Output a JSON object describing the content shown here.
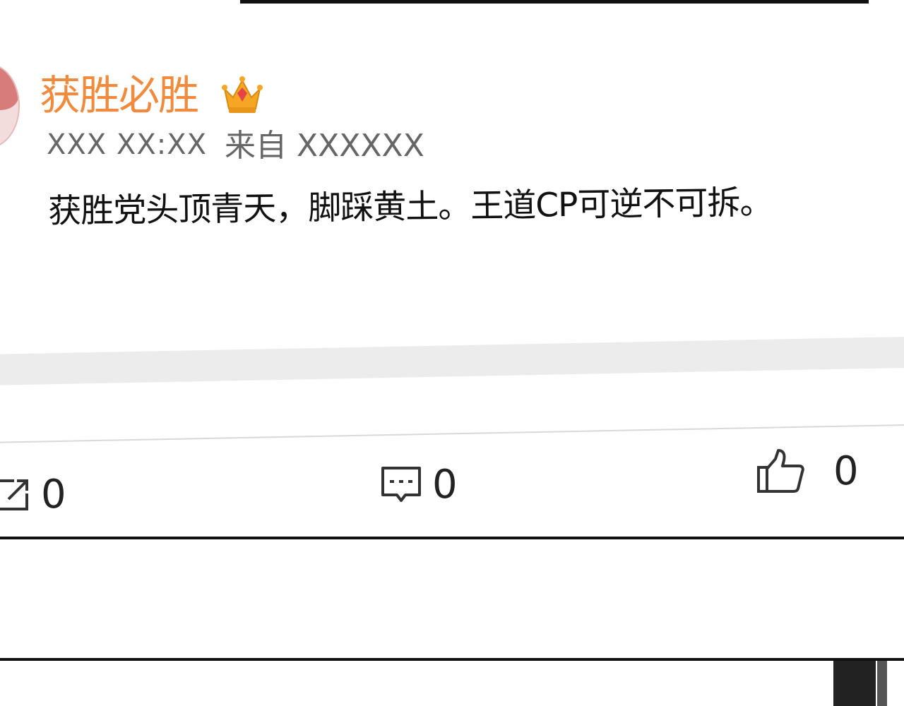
{
  "post": {
    "username": "获胜必胜",
    "badge_icon": "crown-icon",
    "time": "XXX XX:XX",
    "source": "来自 XXXXXX",
    "text": "获胜党头顶青天，脚踩黄土。王道CP可逆不可拆。"
  },
  "actions": {
    "repost_count": "0",
    "comment_count": "0",
    "like_count": "0"
  },
  "colors": {
    "username": "#f08a3c",
    "meta": "#666666",
    "text": "#111111"
  }
}
